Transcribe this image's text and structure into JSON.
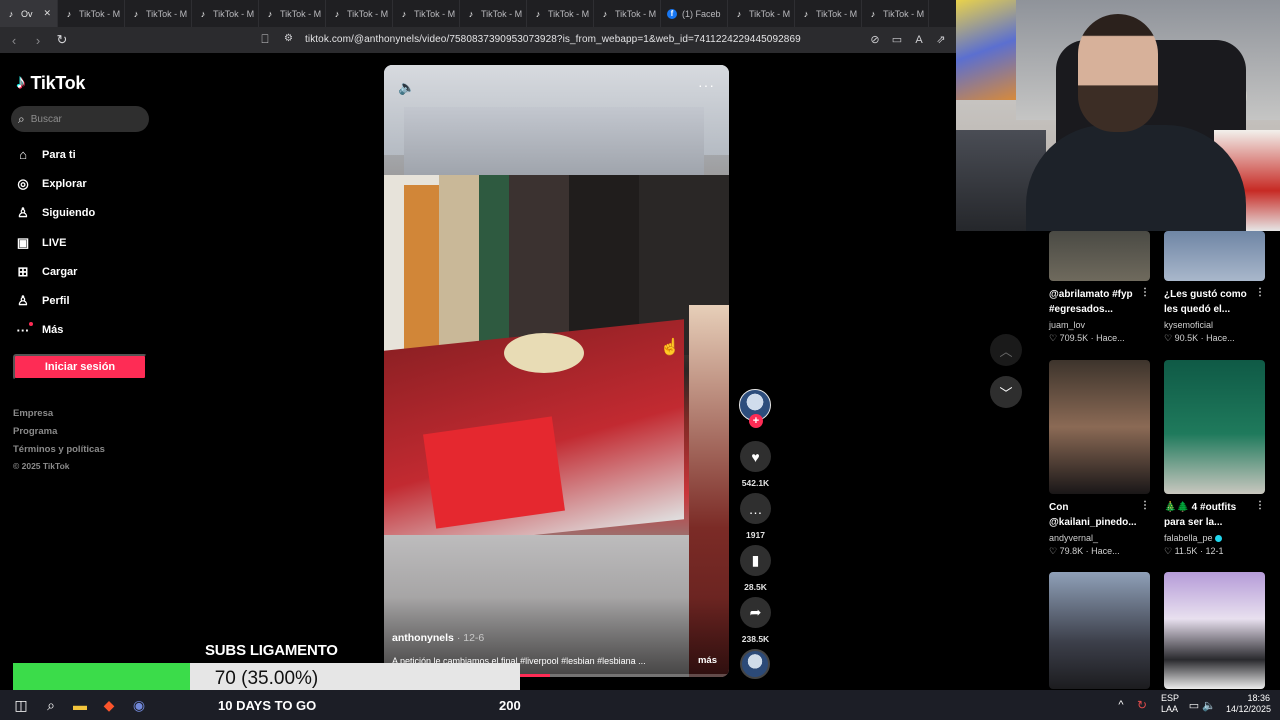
{
  "browser": {
    "tabs": [
      {
        "label": "Ov",
        "active": true
      },
      {
        "label": "TikTok - M"
      },
      {
        "label": "TikTok - M"
      },
      {
        "label": "TikTok - M"
      },
      {
        "label": "TikTok - M"
      },
      {
        "label": "TikTok - M"
      },
      {
        "label": "TikTok - M"
      },
      {
        "label": "TikTok - M"
      },
      {
        "label": "TikTok - M"
      },
      {
        "label": "TikTok - M"
      },
      {
        "label": "(1) Faceb",
        "favicon": "facebook"
      },
      {
        "label": "TikTok - M"
      },
      {
        "label": "TikTok - M"
      },
      {
        "label": "TikTok - M"
      }
    ],
    "url": "tiktok.com/@anthonynels/video/7580837390953073928?is_from_webapp=1&web_id=7411224229445092869"
  },
  "sidebar": {
    "logo_text": "TikTok",
    "search_placeholder": "Buscar",
    "menu": [
      {
        "label": "Para ti",
        "icon": "home-icon"
      },
      {
        "label": "Explorar",
        "icon": "compass-icon"
      },
      {
        "label": "Siguiendo",
        "icon": "following-icon"
      },
      {
        "label": "LIVE",
        "icon": "live-icon"
      },
      {
        "label": "Cargar",
        "icon": "upload-icon"
      },
      {
        "label": "Perfil",
        "icon": "profile-icon"
      },
      {
        "label": "Más",
        "icon": "more-icon"
      }
    ],
    "login_label": "Iniciar sesión",
    "footer_links": [
      "Empresa",
      "Programa",
      "Términos y políticas"
    ],
    "copyright": "© 2025 TikTok"
  },
  "video": {
    "author": "anthonynels",
    "date": "· 12-6",
    "caption": "A petición le cambiamos el final #liverpool #lesbian #lesbiana ...",
    "more_label": "más",
    "progress": 0.48,
    "likes": "542.1K",
    "comments": "1917",
    "saves": "28.5K",
    "shares": "238.5K"
  },
  "recommendations": [
    {
      "title1": "@abrilamato #fyp",
      "title2": "#egresados...",
      "author": "juam_lov",
      "likes": "709.5K",
      "time": "Hace..."
    },
    {
      "title1": "¿Les gustó como",
      "title2": "les quedó el...",
      "author": "kysemoficial",
      "likes": "90.5K",
      "time": "Hace..."
    },
    {
      "title1": "Con",
      "title2": "@kailani_pinedo...",
      "author": "andyvernal_",
      "likes": "79.8K",
      "time": "Hace..."
    },
    {
      "title1": "🎄🌲 4 #outfits",
      "title2": "para ser la...",
      "author": "falabella_pe",
      "likes": "11.5K",
      "time": "12-1",
      "verified": true
    }
  ],
  "stream_overlay": {
    "subs_title": "SUBS LIGAMENTO",
    "progress_text": "70 (35.00%)",
    "progress_fraction": 0.35,
    "days_to_go": "10 DAYS TO GO",
    "goal": "200",
    "fill_color": "#3bdc4a"
  },
  "tray": {
    "lang1": "ESP",
    "lang2": "LAA",
    "time": "18:36",
    "date": "14/12/2025"
  },
  "colors": {
    "accent": "#fe2c55"
  }
}
